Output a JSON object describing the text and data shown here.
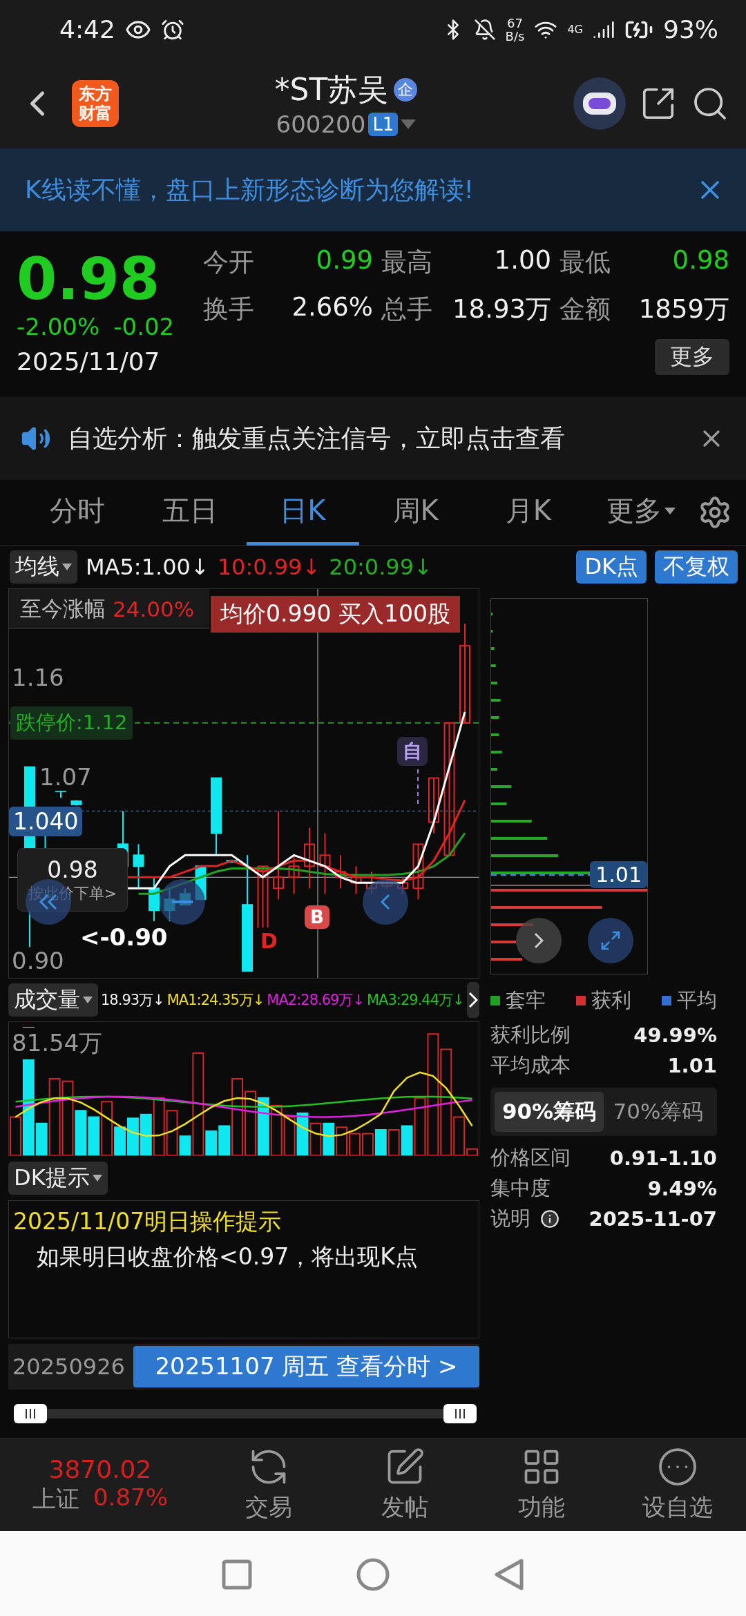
{
  "status_bar": {
    "time": "4:42",
    "net_speed": "67",
    "net_unit": "B/s",
    "network": "4G",
    "battery": "93%"
  },
  "header": {
    "logo": [
      "东方",
      "财富"
    ],
    "title": "*ST苏吴",
    "title_badge": "企",
    "code": "600200",
    "level_badge": "L1"
  },
  "banner": {
    "text": "K线读不懂，盘口上新形态诊断为您解读!"
  },
  "quote": {
    "price": "0.98",
    "change_pct": "-2.00%",
    "change": "-0.02",
    "date": "2025/11/07",
    "more_button": "更多",
    "stats": [
      {
        "label": "今开",
        "value": "0.99",
        "color": "#1fcc1f"
      },
      {
        "label": "最高",
        "value": "1.00",
        "color": "#f0f0f0"
      },
      {
        "label": "最低",
        "value": "0.98",
        "color": "#1fcc1f"
      },
      {
        "label": "换手",
        "value": "2.66%",
        "color": "#f0f0f0"
      },
      {
        "label": "总手",
        "value": "18.93万",
        "color": "#f0f0f0"
      },
      {
        "label": "金额",
        "value": "1859万",
        "color": "#f0f0f0"
      }
    ]
  },
  "notice": {
    "text": "自选分析：触发重点关注信号，立即点击查看"
  },
  "tabs": [
    {
      "label": "分时",
      "selected": false,
      "dropdown": false
    },
    {
      "label": "五日",
      "selected": false,
      "dropdown": false
    },
    {
      "label": "日K",
      "selected": true,
      "dropdown": false
    },
    {
      "label": "周K",
      "selected": false,
      "dropdown": false
    },
    {
      "label": "月K",
      "selected": false,
      "dropdown": false
    },
    {
      "label": "更多",
      "selected": false,
      "dropdown": true
    }
  ],
  "ma_bar": {
    "selector": "均线",
    "dk_button": "DK点",
    "adjust_button": "不复权",
    "items": [
      {
        "text": "MA5:1.00↓",
        "color": "#f2f2f2"
      },
      {
        "text": "10:0.99↓",
        "color": "#e02424"
      },
      {
        "text": "20:0.99↓",
        "color": "#22b022"
      }
    ]
  },
  "kline": {
    "range_label": "至今涨幅",
    "range_value": "24.00%",
    "tooltip": "均价0.990  买入100股",
    "limit_label": "跌停价:1.12",
    "y_labels": [
      "1.16",
      "1.07",
      "0.90"
    ],
    "crosshair_price": "1.040",
    "order_price": "0.98",
    "order_action": "按此价下单>",
    "min_label": "<-0.90",
    "signal_marker": "自",
    "buy_marker": "B",
    "sell_marker": "D"
  },
  "chip": {
    "avg_label": "1.01"
  },
  "volume": {
    "selector": "成交量",
    "max_label": "81.54万",
    "items": [
      {
        "text": "18.93万↓",
        "color": "#f2f2f2"
      },
      {
        "text": "MA1:24.35万↓",
        "color": "#f0e020"
      },
      {
        "text": "MA2:28.69万↓",
        "color": "#e020e0"
      },
      {
        "text": "MA3:29.44万↓",
        "color": "#22c022"
      }
    ]
  },
  "chip_stats": {
    "legend": [
      {
        "label": "套牢",
        "color": "#22a022"
      },
      {
        "label": "获利",
        "color": "#d03030"
      },
      {
        "label": "平均",
        "color": "#3070d0"
      }
    ],
    "rows": [
      {
        "label": "获利比例",
        "value": "49.99%"
      },
      {
        "label": "平均成本",
        "value": "1.01"
      }
    ],
    "ranges": [
      {
        "label": "90%筹码",
        "selected": true
      },
      {
        "label": "70%筹码",
        "selected": false
      }
    ],
    "details": [
      {
        "label": "价格区间",
        "value": "0.91-1.10",
        "info": false
      },
      {
        "label": "集中度",
        "value": "9.49%",
        "info": false
      },
      {
        "label": "说明",
        "value": "2025-11-07",
        "info": true
      }
    ]
  },
  "dk": {
    "selector": "DK提示",
    "title": "2025/11/07明日操作提示",
    "text": "如果明日收盘价格<0.97，将出现K点"
  },
  "date_bar": {
    "start": "20250926",
    "current": "20251107 周五 查看分时 >"
  },
  "slider": {
    "handles": [
      {
        "level": 0
      },
      {
        "level": 1
      }
    ]
  },
  "bottom_nav": {
    "index": {
      "value": "3870.02",
      "name": "上证",
      "change": "0.87%"
    },
    "items": [
      {
        "label": "交易",
        "kind": "trade"
      },
      {
        "label": "发帖",
        "kind": "post"
      },
      {
        "label": "功能",
        "kind": "apps"
      },
      {
        "label": "设自选",
        "kind": "more"
      }
    ]
  }
}
